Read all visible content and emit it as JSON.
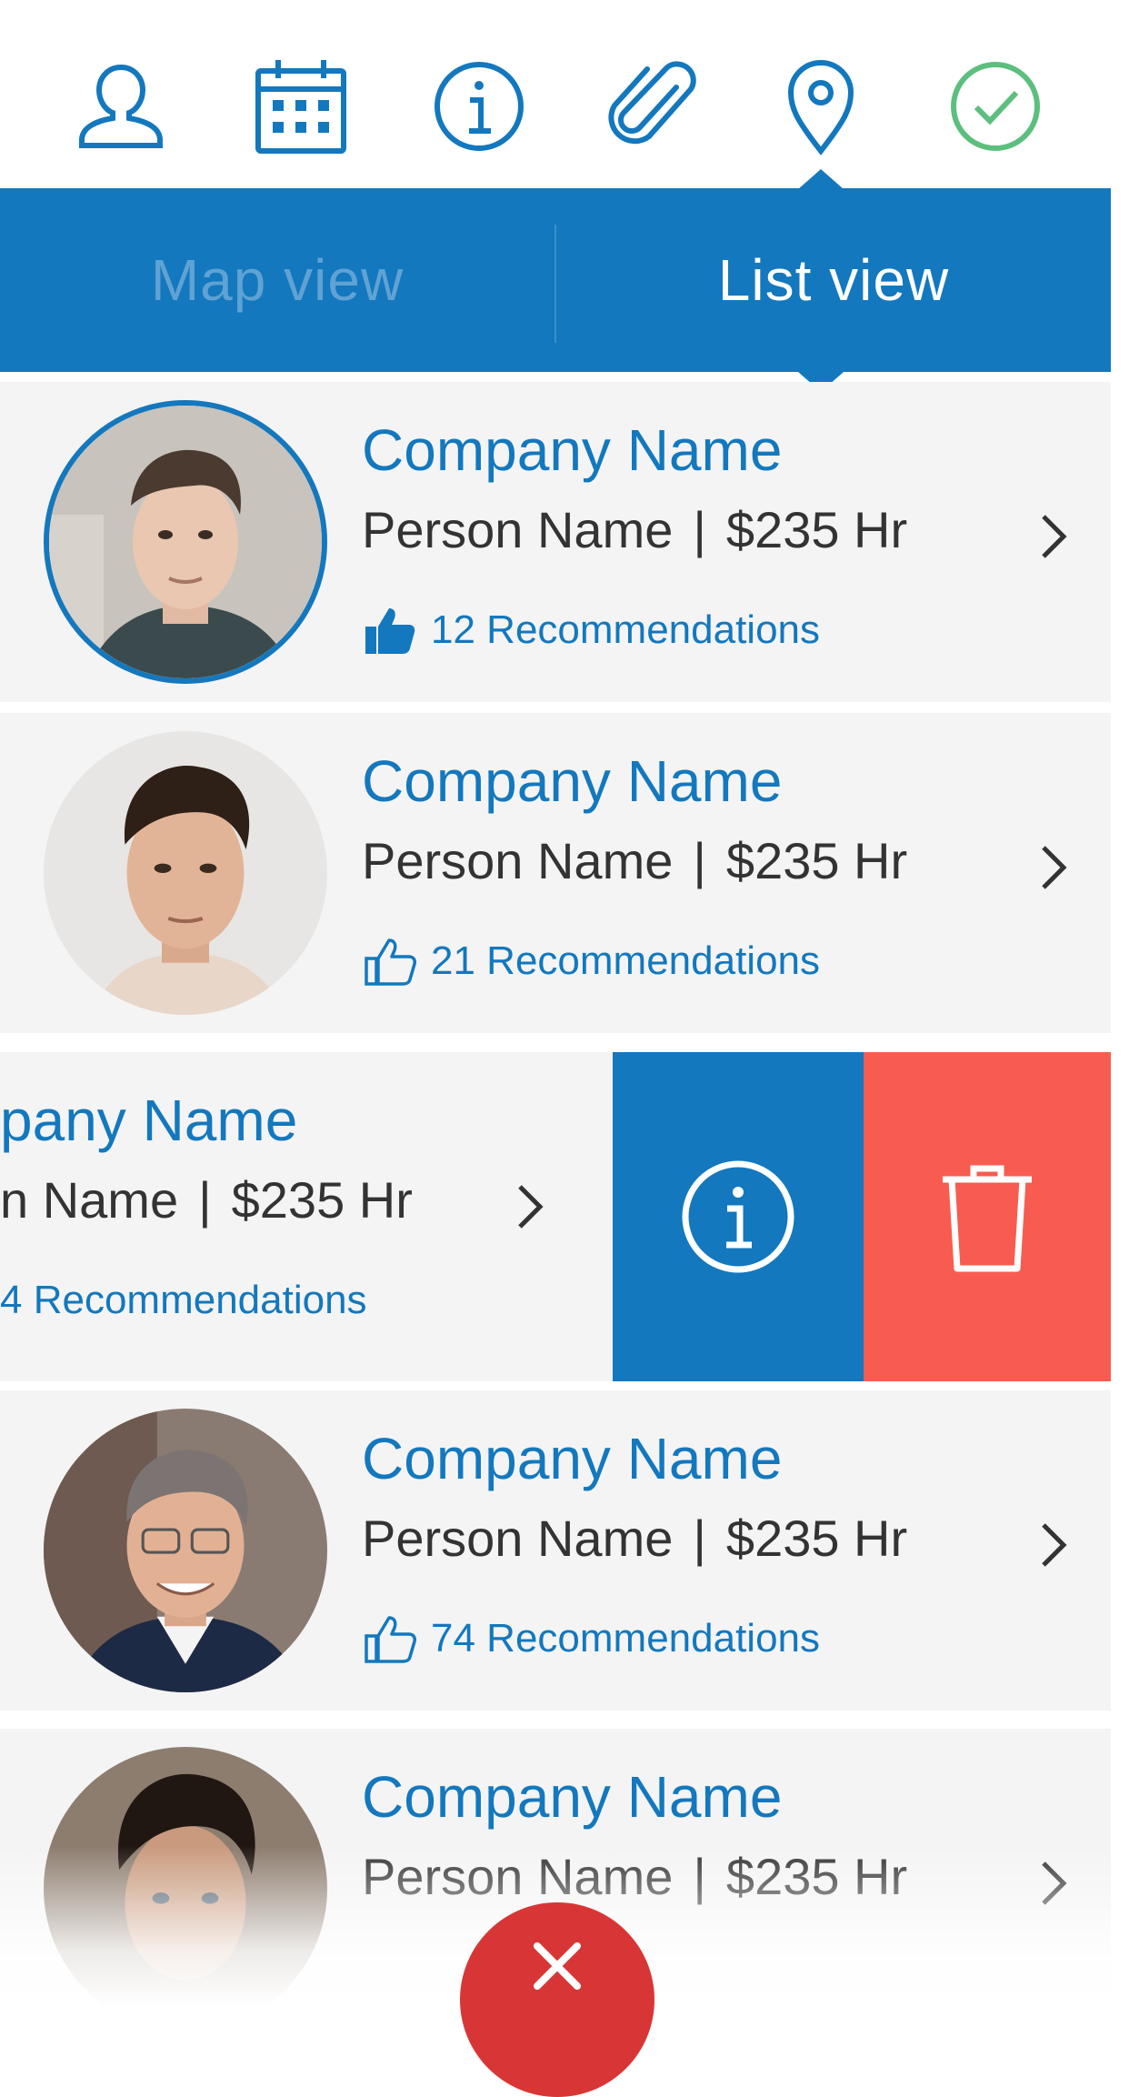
{
  "toolbar": {
    "icons": [
      "person-icon",
      "calendar-icon",
      "info-icon",
      "attachment-icon",
      "location-pin-icon",
      "check-circle-icon"
    ],
    "active_color": "#1378be",
    "check_color": "#5cbf7d"
  },
  "tabs": {
    "map_view": "Map view",
    "list_view": "List view",
    "selected": "List view"
  },
  "list": {
    "separator": "|",
    "rows": [
      {
        "company": "Company Name",
        "person": "Person Name",
        "rate": "$235 Hr",
        "recommendations": "12 Recommendations",
        "thumb": "filled",
        "selected": true
      },
      {
        "company": "Company Name",
        "person": "Person Name",
        "rate": "$235 Hr",
        "recommendations": "21 Recommendations",
        "thumb": "outline",
        "selected": false
      },
      {
        "company": "pany Name",
        "person": "n Name",
        "rate": "$235 Hr",
        "recommendations": "4 Recommendations",
        "thumb": "none",
        "selected": false,
        "swiped": true
      },
      {
        "company": "Company Name",
        "person": "Person Name",
        "rate": "$235 Hr",
        "recommendations": "74 Recommendations",
        "thumb": "outline",
        "selected": false
      },
      {
        "company": "Company Name",
        "person": "Person Name",
        "rate": "$235 Hr",
        "recommendations": "",
        "thumb": "none",
        "selected": false
      }
    ]
  },
  "swipe_actions": {
    "info_color": "#1378be",
    "delete_color": "#f85c50"
  },
  "close_button": {
    "color": "#d83636"
  }
}
